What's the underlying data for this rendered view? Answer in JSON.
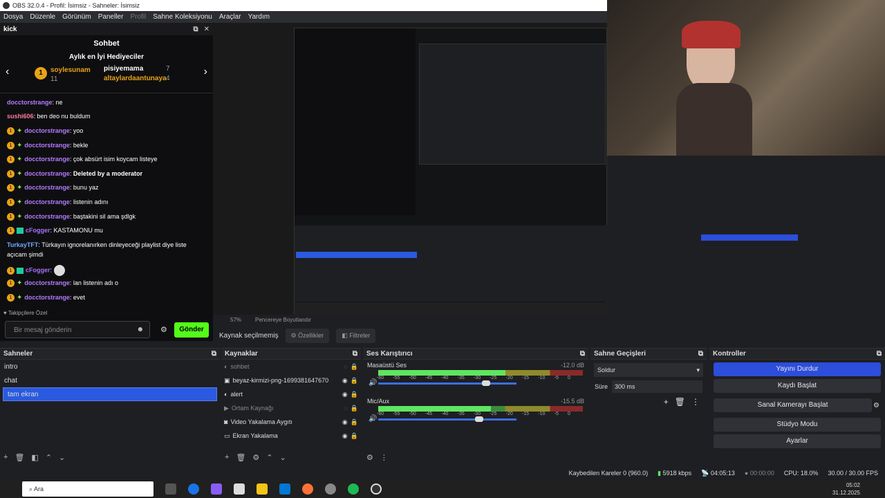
{
  "window": {
    "title": "OBS 32.0.4 - Profil: İsimsiz - Sahneler: İsimsiz"
  },
  "menu": [
    "Dosya",
    "Düzenle",
    "Görünüm",
    "Paneller",
    "Profil",
    "Sahne Koleksiyonu",
    "Araçlar",
    "Yardım"
  ],
  "chat": {
    "dock_title": "kick",
    "title": "Sohbet",
    "gifters_title": "Aylık en İyi Hediyeciler",
    "gifters": [
      {
        "name": "soylesunam",
        "count": "11"
      },
      {
        "name": "pisiyemama",
        "count": "7"
      },
      {
        "name": "altaylardaantunaya",
        "count": "4"
      }
    ],
    "messages": [
      {
        "user": "sushi606",
        "text": "ben deo nu buldum"
      },
      {
        "user": "docctorstrange",
        "text": "yoo"
      },
      {
        "user": "docctorstrange",
        "text": "bekle"
      },
      {
        "user": "docctorstrange",
        "text": "çok absürt isim koycam listeye"
      },
      {
        "user": "docctorstrange",
        "text": "Deleted by a moderator"
      },
      {
        "user": "docctorstrange",
        "text": "bunu yaz"
      },
      {
        "user": "docctorstrange",
        "text": "listenin adını"
      },
      {
        "user": "docctorstrange",
        "text": "baştakini sil ama şdlgk"
      },
      {
        "user": "cFogger",
        "text": "KASTAMONU mu"
      },
      {
        "user": "TurkayTFT",
        "text": "Türkayın ignorelanırken dinleyeceği playlist diye liste"
      },
      {
        "user": "",
        "text": "açıcam şimdi"
      },
      {
        "user": "cFogger",
        "text": ""
      },
      {
        "user": "docctorstrange",
        "text": "lan listenin adı o"
      },
      {
        "user": "docctorstrange",
        "text": "evet"
      }
    ],
    "top_partial_user": "docctorstrange",
    "top_partial_text": "ne",
    "followers_only": "Takipçilere Özel",
    "input_placeholder": "Bir mesaj gönderin",
    "send_label": "Gönder"
  },
  "preview": {
    "zoom": "57%",
    "fit": "Pencereye Boyutlandır"
  },
  "source_bar": {
    "selected": "Kaynak seçilmemiş",
    "properties": "Özellikler",
    "filters": "Filtreler"
  },
  "scenes": {
    "title": "Sahneler",
    "items": [
      "intro",
      "chat",
      "tam ekran"
    ],
    "selected_index": 2
  },
  "sources": {
    "title": "Kaynaklar",
    "items": [
      {
        "name": "sohbet",
        "visible": false
      },
      {
        "name": "beyaz-kirmizi-png-1699381647670",
        "visible": true
      },
      {
        "name": "alert",
        "visible": true
      },
      {
        "name": "Ortam Kaynağı",
        "visible": false
      },
      {
        "name": "Video Yakalama Aygıtı",
        "visible": true
      },
      {
        "name": "Ekran Yakalama",
        "visible": true
      }
    ]
  },
  "mixer": {
    "title": "Ses Karıştırıcı",
    "channels": [
      {
        "name": "Masaüstü Ses",
        "db": "-12.0 dB",
        "level": 0.62,
        "volume": 0.75
      },
      {
        "name": "Mic/Aux",
        "db": "-15.5 dB",
        "level": 0.55,
        "volume": 0.7
      }
    ],
    "ticks": [
      "-60",
      "-55",
      "-50",
      "-45",
      "-40",
      "-35",
      "-30",
      "-25",
      "-20",
      "-15",
      "-10",
      "-5",
      "0"
    ]
  },
  "transitions": {
    "title": "Sahne Geçişleri",
    "type": "Soldur",
    "duration_label": "Süre",
    "duration": "300 ms"
  },
  "controls": {
    "title": "Kontroller",
    "buttons": [
      "Yayını Durdur",
      "Kaydı Başlat",
      "Sanal Kamerayı Başlat",
      "Stüdyo Modu",
      "Ayarlar"
    ]
  },
  "status": {
    "dropped": "Kaybedilen Kareler 0 (960.0)",
    "bitrate": "5918 kbps",
    "live_time": "04:05:13",
    "rec_time": "00:00:00",
    "cpu": "CPU: 18.0%",
    "fps": "30.00 / 30.00 FPS"
  },
  "taskbar": {
    "search": "Ara",
    "time": "05:02",
    "date": "31.12.2025"
  }
}
